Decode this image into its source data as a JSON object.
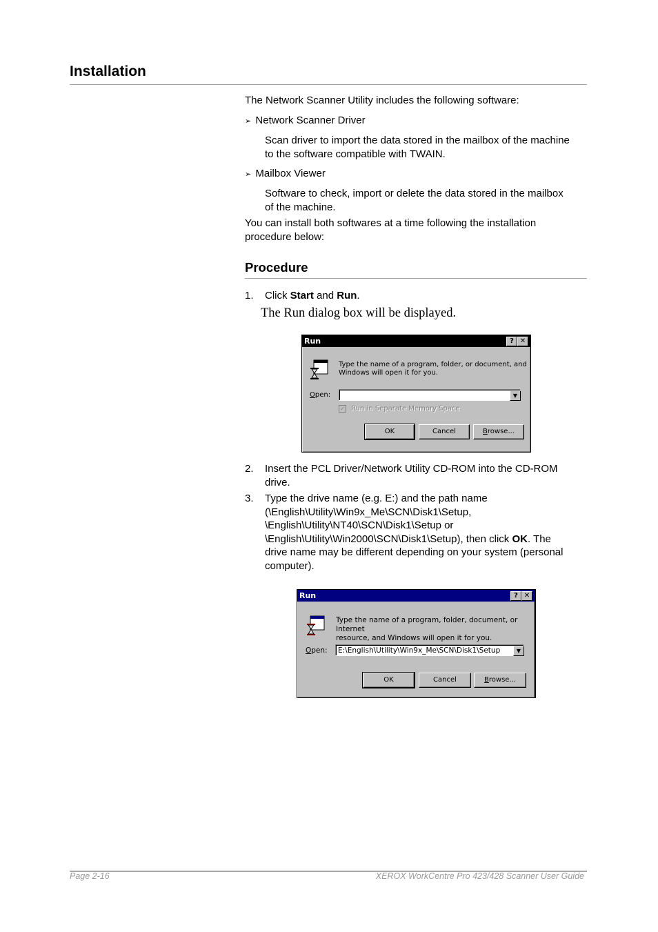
{
  "heading": "Installation",
  "intro": "The Network Scanner Utility includes the following software:",
  "software": [
    {
      "name": "Network Scanner Driver",
      "desc_line1": "Scan driver to import the data stored in the mailbox of the machine",
      "desc_line2": "to the software compatible with TWAIN."
    },
    {
      "name": "Mailbox Viewer",
      "desc_line1": "Software to check, import or delete the data stored in the mailbox",
      "desc_line2": "of the machine."
    }
  ],
  "bullet_glyph": "➢",
  "install_note_line1": "You can install both softwares at a time following the installation",
  "install_note_line2": "procedure below:",
  "procedure_heading": "Procedure",
  "steps": [
    {
      "num": "1.",
      "pre": "Click ",
      "b1": "Start",
      "mid": " and ",
      "b2": "Run",
      "post": "."
    },
    {
      "num": "2.",
      "line1": "Insert the PCL Driver/Network Utility CD-ROM into the CD-ROM",
      "line2": "drive."
    },
    {
      "num": "3.",
      "line1": "Type the drive name (e.g. E:) and the path name",
      "line2": "(\\English\\Utility\\Win9x_Me\\SCN\\Disk1\\Setup,",
      "line3": "\\English\\Utility\\NT40\\SCN\\Disk1\\Setup or",
      "line4_pre": "\\English\\Utility\\Win2000\\SCN\\Disk1\\Setup), then click ",
      "line4_bold": "OK",
      "line4_post": ". The",
      "line5": "drive name may be different depending on your system (personal",
      "line6": "computer)."
    }
  ],
  "step1_result": "The Run dialog box will be displayed.",
  "dialog1": {
    "title": "Run",
    "title_color": "#000000",
    "help": "?",
    "close": "✕",
    "prompt_line1": "Type the name of a program, folder, or document, and",
    "prompt_line2": "Windows will open it for you.",
    "open_label_u": "O",
    "open_label_rest": "pen:",
    "open_value": "",
    "checkbox_label": "Run in Separate Memory Space",
    "checkbox_checked": true,
    "ok": "OK",
    "cancel": "Cancel",
    "browse_u": "B",
    "browse_rest": "rowse..."
  },
  "dialog2": {
    "title": "Run",
    "title_color": "#000080",
    "help": "?",
    "close": "✕",
    "prompt_line1": "Type the name of a program, folder, document, or Internet",
    "prompt_line2": "resource, and Windows will open it for you.",
    "open_label_u": "O",
    "open_label_rest": "pen:",
    "open_value": "E:\\English\\Utility\\Win9x_Me\\SCN\\Disk1\\Setup",
    "ok": "OK",
    "cancel": "Cancel",
    "browse_u": "B",
    "browse_rest": "rowse..."
  },
  "footer": {
    "page": "Page 2-16",
    "guide": "XEROX WorkCentre Pro 423/428 Scanner User Guide"
  }
}
